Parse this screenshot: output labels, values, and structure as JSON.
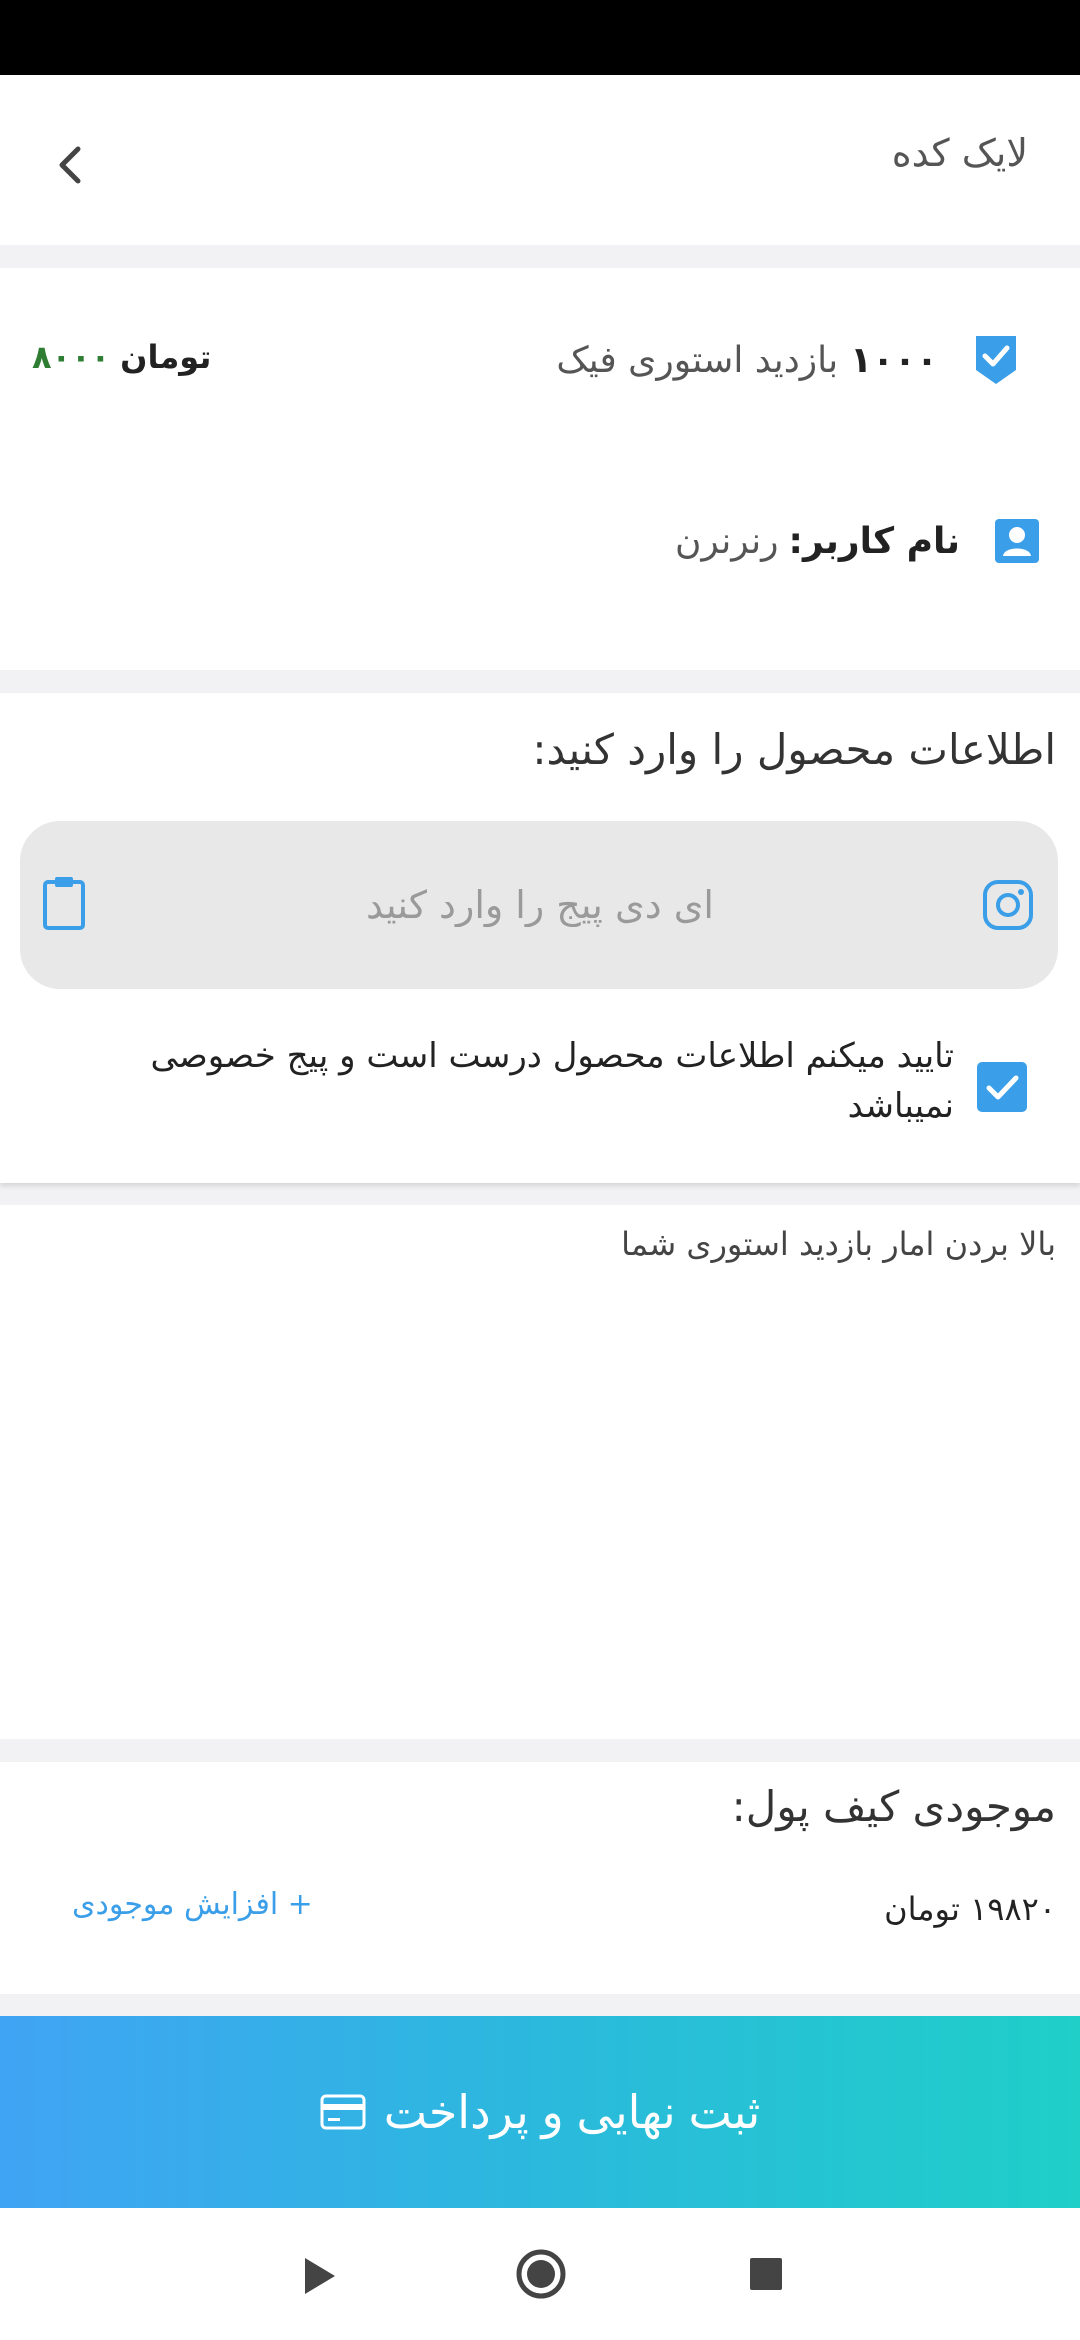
{
  "app": {
    "title": "لایک کده"
  },
  "order": {
    "quantity": "۱۰۰۰",
    "label": "بازدید استوری فیک",
    "price_value": "۸۰۰۰",
    "price_unit": "تومان"
  },
  "user": {
    "label": "نام کاربر:",
    "value": "رنرنرن"
  },
  "product": {
    "title": "اطلاعات محصول را وارد کنید:",
    "input_placeholder": "ای دی پیج را وارد کنید",
    "input_value": "",
    "confirm_text": "تایید میکنم اطلاعات محصول درست است و پیج خصوصی نمیباشد",
    "confirm_checked": true
  },
  "description": "بالا بردن امار بازدید استوری شما",
  "wallet": {
    "title": "موجودی کیف پول:",
    "balance": "۱۹۸۲۰ تومان",
    "add_label": "+ افزایش موجودی"
  },
  "pay_button": {
    "label": "ثبت نهایی و پرداخت"
  },
  "colors": {
    "accent": "#3a9ee8",
    "price": "#2e7d32",
    "gradient_start": "#40a4f4",
    "gradient_end": "#1fcfc8"
  },
  "icons": [
    "chevron-left-icon",
    "shield-check-icon",
    "user-icon",
    "instagram-icon",
    "clipboard-icon",
    "checkbox-icon",
    "credit-card-icon",
    "nav-back-icon",
    "nav-home-icon",
    "nav-recent-icon"
  ]
}
